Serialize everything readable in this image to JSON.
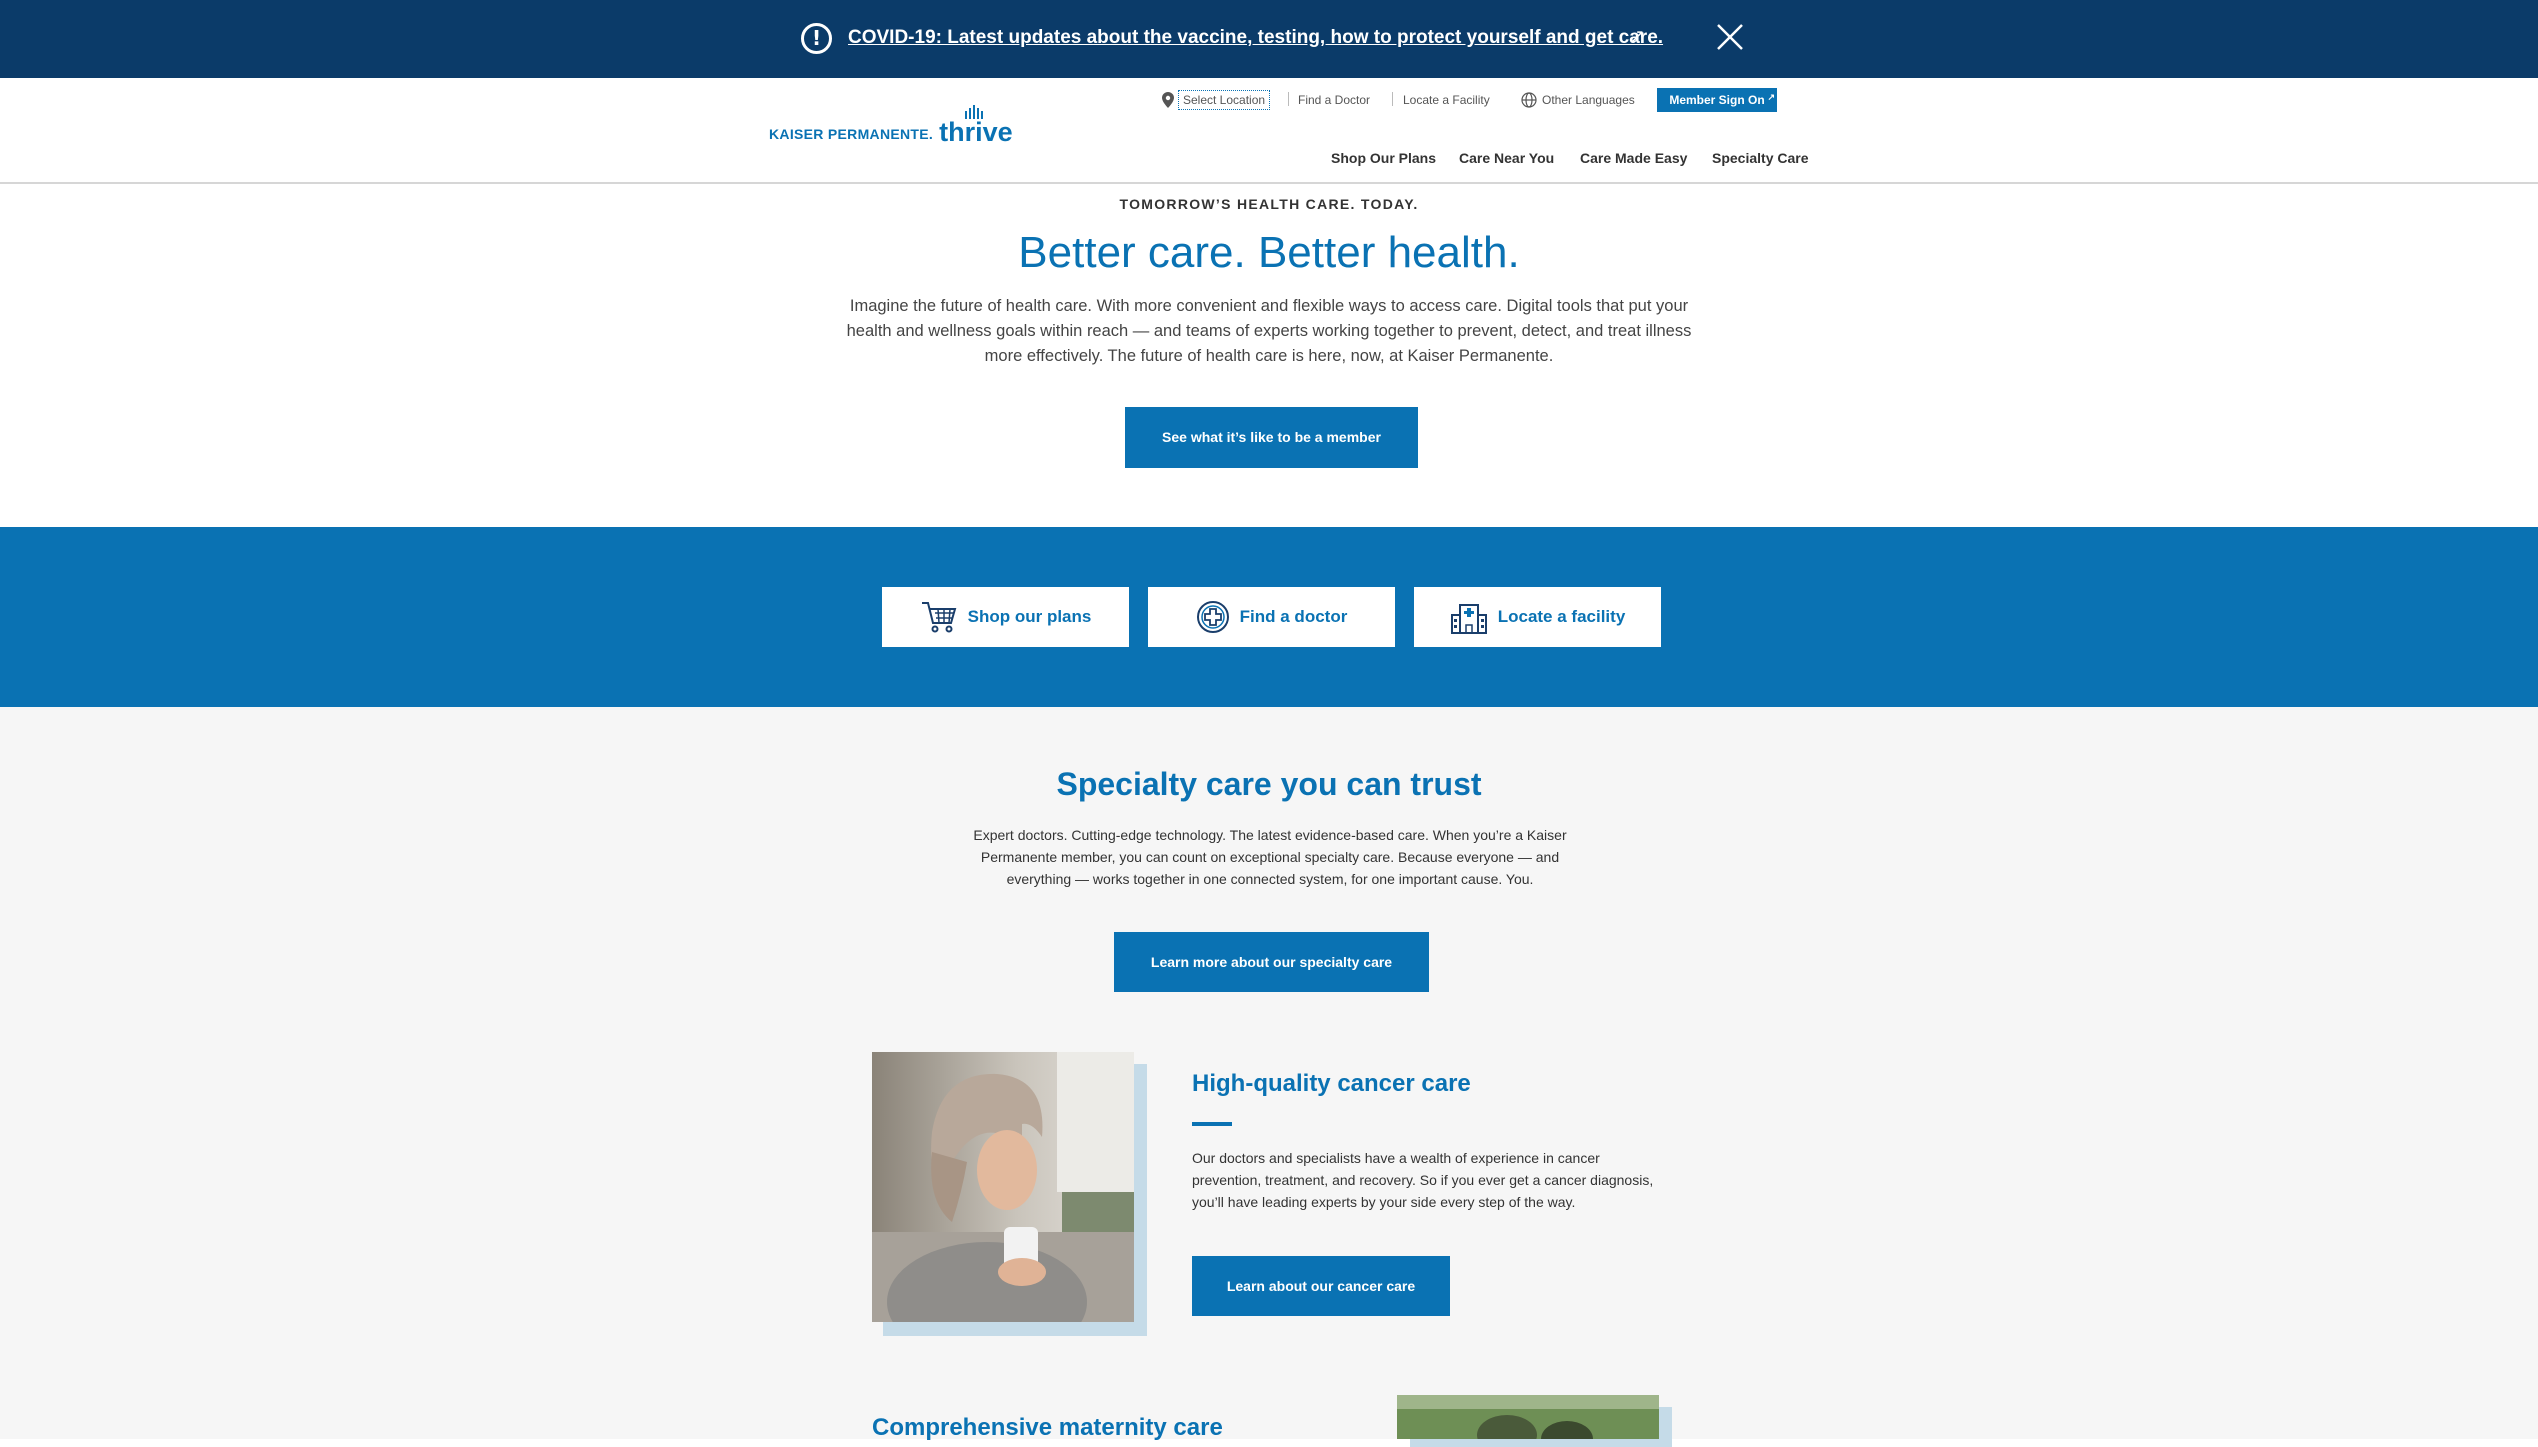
{
  "banner": {
    "icon": "alert-circle-icon",
    "link_text": "COVID-19: Latest updates about the vaccine, testing, how to protect yourself and get care.",
    "external_icon": "external-link-icon",
    "close_icon": "close-icon"
  },
  "header": {
    "logo": {
      "brand": "KAISER PERMANENTE.",
      "tagline": "thrive"
    },
    "utility": {
      "select_location": "Select Location",
      "find_doctor": "Find a Doctor",
      "locate_facility": "Locate a Facility",
      "other_languages": "Other Languages",
      "member_sign_on": "Member Sign On"
    },
    "nav": [
      "Shop Our Plans",
      "Care Near You",
      "Care Made Easy",
      "Specialty Care"
    ]
  },
  "hero": {
    "eyebrow": "TOMORROW’S HEALTH CARE. TODAY.",
    "title": "Better care. Better health.",
    "body": "Imagine the future of health care. With more convenient and flexible ways to access care. Digital tools that put your health and wellness goals within reach — and teams of experts working together to prevent, detect, and treat illness more effectively. The future of health care is here, now, at Kaiser Permanente.",
    "cta": "See what it’s like to be a member"
  },
  "quick_links": [
    {
      "label": "Shop our plans",
      "icon": "shopping-cart-icon"
    },
    {
      "label": "Find a doctor",
      "icon": "medical-cross-icon"
    },
    {
      "label": "Locate a facility",
      "icon": "hospital-building-icon"
    }
  ],
  "specialty": {
    "title": "Specialty care you can trust",
    "body": "Expert doctors. Cutting-edge technology. The latest evidence-based care. When you’re a Kaiser Permanente member, you can count on exceptional specialty care. Because everyone — and everything — works together in one connected system, for one important cause. You.",
    "cta": "Learn more about our specialty care"
  },
  "cancer": {
    "title": "High-quality cancer care",
    "body": "Our doctors and specialists have a wealth of experience in cancer prevention, treatment, and recovery. So if you ever get a cancer diagnosis, you’ll have leading experts by your side every step of the way.",
    "cta": "Learn about our cancer care"
  },
  "maternity": {
    "title": "Comprehensive maternity care"
  },
  "colors": {
    "banner_bg": "#0b3b69",
    "brand_blue": "#0a72b3",
    "section_gray": "#f6f6f6"
  }
}
